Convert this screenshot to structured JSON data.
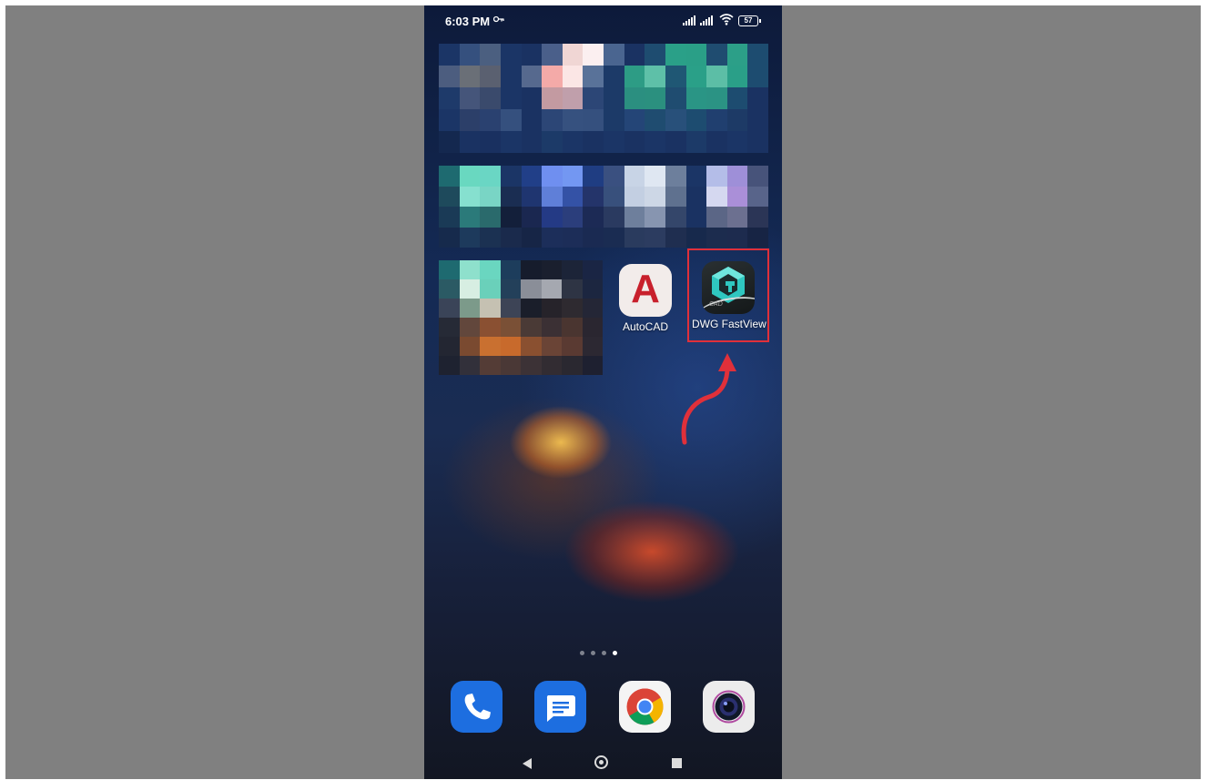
{
  "status_bar": {
    "time": "6:03 PM",
    "battery": "57",
    "icons": [
      "key-icon",
      "signal-icon",
      "signal-icon",
      "wifi-icon",
      "battery-icon"
    ]
  },
  "apps": {
    "autocad": {
      "label": "AutoCAD",
      "glyph": "A",
      "color": "#c8202c"
    },
    "dwg_fastview": {
      "label": "DWG FastView",
      "tag": "CAD",
      "accent": "#2fc7c0"
    }
  },
  "annotation": {
    "highlight_color": "#e0303a",
    "arrow_color": "#e0303a"
  },
  "page_indicator": {
    "count": 4,
    "active": 4
  },
  "dock": [
    "phone-icon",
    "messages-icon",
    "chrome-icon",
    "camera-icon"
  ],
  "nav_bar": [
    "back-icon",
    "home-icon",
    "recents-icon"
  ]
}
